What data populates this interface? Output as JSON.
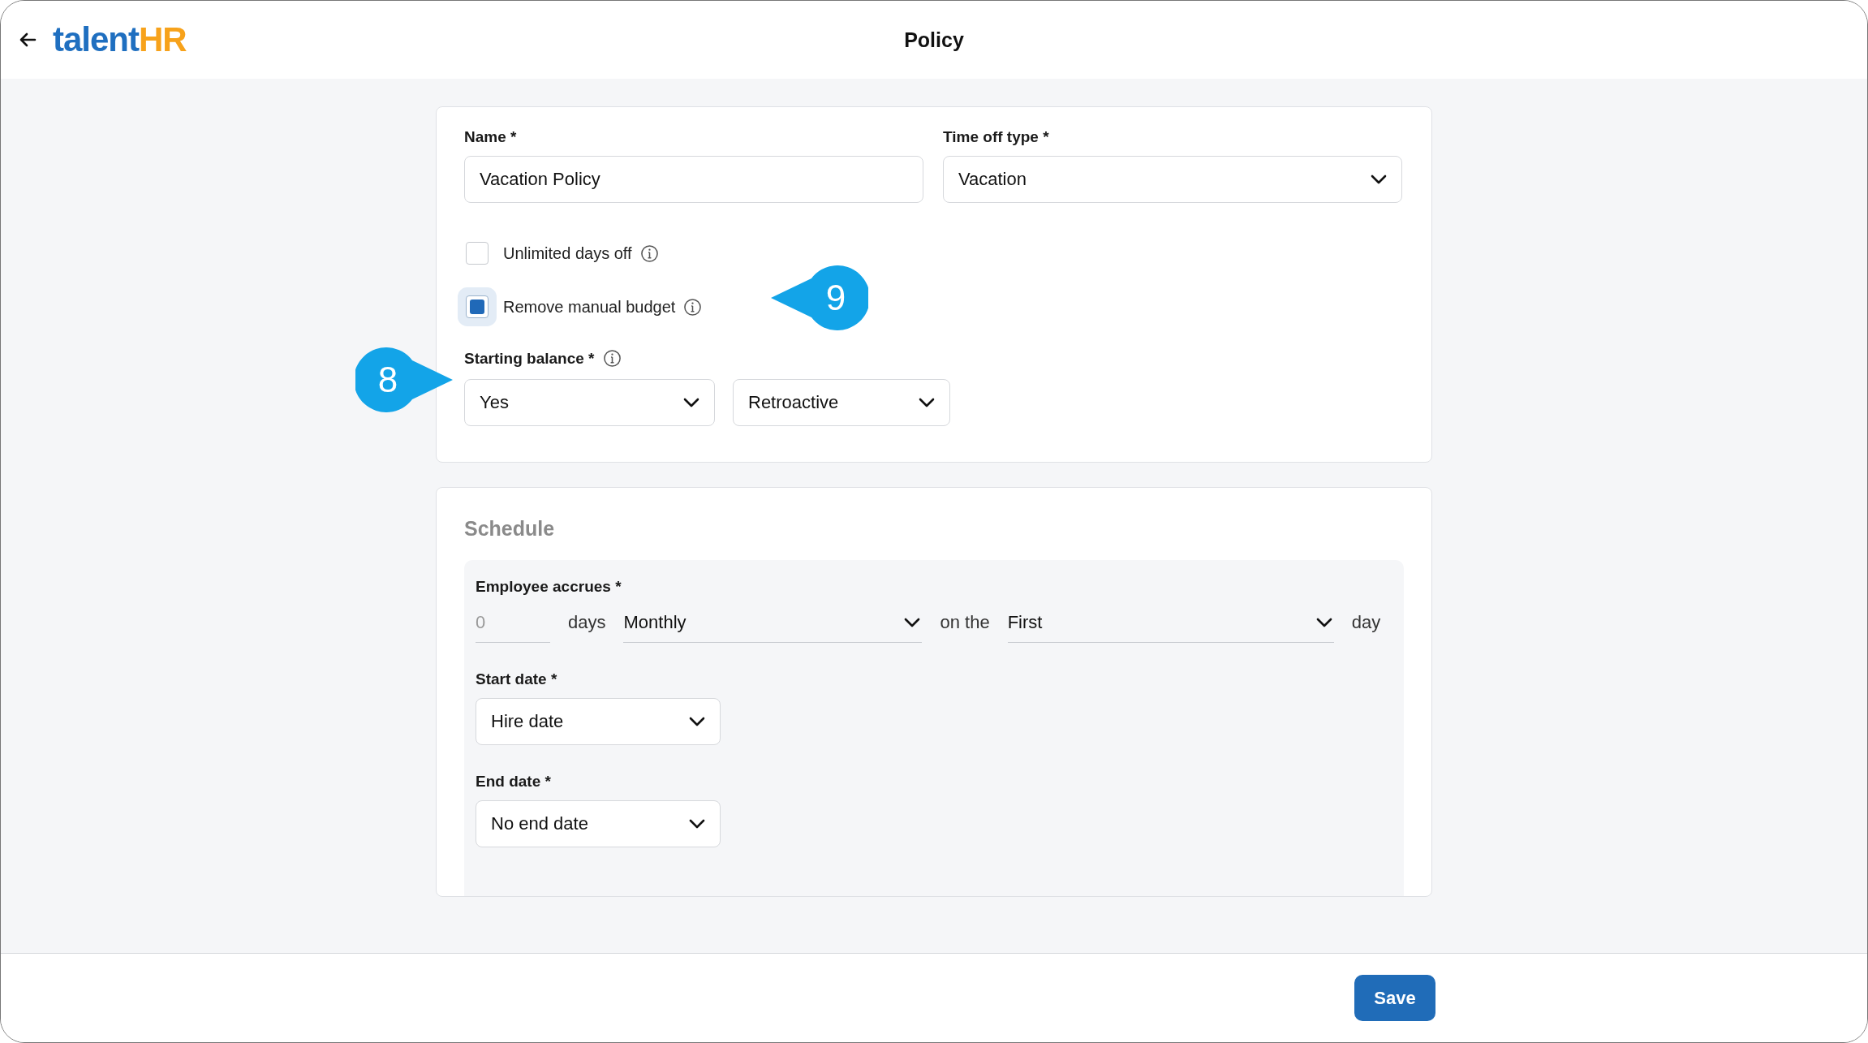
{
  "header": {
    "logo": {
      "word": "talent",
      "accent": "HR"
    },
    "title": "Policy"
  },
  "general": {
    "name": {
      "label": "Name *",
      "value": "Vacation Policy"
    },
    "time_off_type": {
      "label": "Time off type *",
      "value": "Vacation"
    },
    "options": [
      {
        "label": "Unlimited days off",
        "checked": false,
        "focused": false
      },
      {
        "label": "Remove manual budget",
        "checked": true,
        "focused": true,
        "callout": "9"
      }
    ],
    "starting_balance": {
      "label": "Starting balance *",
      "callout": "8",
      "selects": [
        "Yes",
        "Retroactive"
      ]
    }
  },
  "schedule": {
    "title": "Schedule",
    "accrual": {
      "label": "Employee accrues *",
      "amount_placeholder": "0",
      "unit": "days",
      "frequency": "Monthly",
      "connector": "on the",
      "day": "First",
      "suffix": "day"
    },
    "start_date": {
      "label": "Start date *",
      "value": "Hire date"
    },
    "end_date": {
      "label": "End date *",
      "value": "No end date"
    }
  },
  "footer": {
    "save": "Save"
  }
}
